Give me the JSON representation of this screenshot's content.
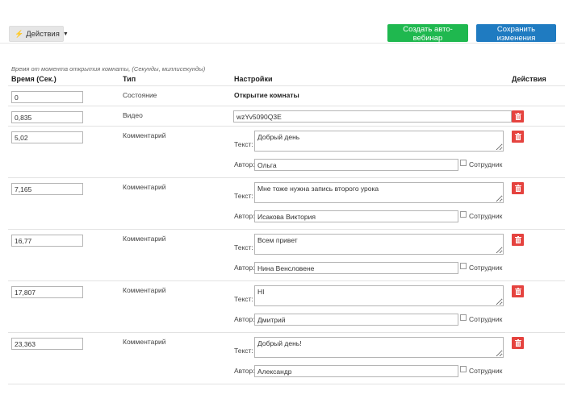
{
  "toolbar": {
    "actions_label": "Действия",
    "create_label": "Создать авто-вебинар",
    "save_label": "Сохранить изменения",
    "colors": {
      "create": "#1fb84f",
      "save": "#1f7bc1",
      "delete": "#e5433f"
    }
  },
  "table": {
    "hint": "Время от момента открытия комнаты, (Секунды, миллисекунды)",
    "headers": {
      "time": "Время (Сек.)",
      "type": "Тип",
      "settings": "Настройки",
      "actions": "Действия"
    },
    "text_label": "Текст:",
    "author_label": "Автор:",
    "employee_label": "Сотрудник",
    "rows": [
      {
        "time": "0",
        "type": "Состояние",
        "settings": "Открытие комнаты"
      },
      {
        "time": "0,835",
        "type": "Видео",
        "video_id": "wzYv5090Q3E"
      },
      {
        "time": "5,02",
        "type": "Комментарий",
        "text": "Добрый день",
        "author": "Ольга"
      },
      {
        "time": "7,165",
        "type": "Комментарий",
        "text": "Мне тоже нужна запись второго урока",
        "author": "Исакова Виктория"
      },
      {
        "time": "16,77",
        "type": "Комментарий",
        "text": "Всем привет",
        "author": "Нина Венсловене"
      },
      {
        "time": "17,807",
        "type": "Комментарий",
        "text": "HI",
        "author": "Дмитрий"
      },
      {
        "time": "23,363",
        "type": "Комментарий",
        "text": "Добрый день!",
        "author": "Александр"
      }
    ]
  }
}
